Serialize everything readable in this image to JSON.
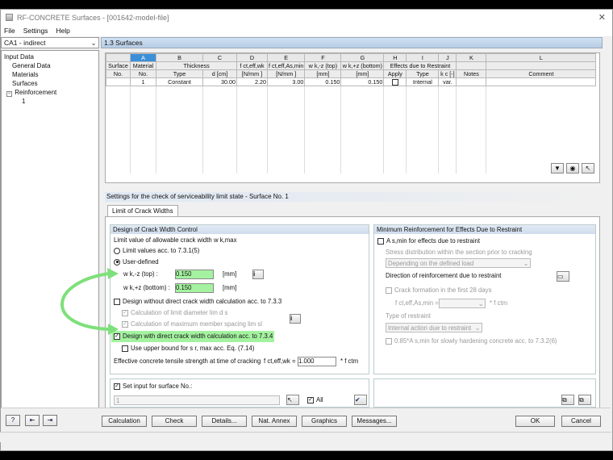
{
  "window": {
    "title": "RF-CONCRETE Surfaces - [001642-model-file]",
    "close": "✕"
  },
  "menu": [
    "File",
    "Settings",
    "Help"
  ],
  "case_selector": {
    "value": "CA1 - indirect"
  },
  "tree": {
    "root": "Input Data",
    "items": [
      "General Data",
      "Materials",
      "Surfaces",
      "Reinforcement"
    ],
    "sub": "1"
  },
  "section_title": "1.3 Surfaces",
  "table": {
    "letters": [
      "A",
      "B",
      "C",
      "D",
      "E",
      "F",
      "G",
      "H",
      "I",
      "J",
      "K",
      "L"
    ],
    "header_top": {
      "surface": "Surface",
      "material": "Material",
      "thickness": "Thickness",
      "fct_eff_wk": "f ct,eff,wk",
      "fct_eff_as": "f ct,eff,As,min",
      "wk_top": "w k,-z (top)",
      "wk_bottom": "w k,+z (bottom)",
      "effects": "Effects due to Restraint",
      "k": "",
      "k_label": "",
      "comment": ""
    },
    "header_bottom": {
      "surface": "No.",
      "material": "No.",
      "type": "Type",
      "d": "d [cm]",
      "fct_eff_wk": "[N/mm ]",
      "fct_eff_as": "[N/mm ]",
      "wk_top": "[mm]",
      "wk_bottom": "[mm]",
      "apply": "Apply",
      "type2": "Type",
      "kc": "k c [-]",
      "notes": "Notes",
      "comment": "Comment"
    },
    "rows": [
      {
        "no": "1",
        "material": "1",
        "type": "Constant",
        "d": "30.00",
        "fct_wk": "2.20",
        "fct_as": "3.00",
        "wk_top": "0.150",
        "wk_bottom": "0.150",
        "type2": "Internal",
        "kc": "var.",
        "notes": "",
        "comment": ""
      }
    ]
  },
  "settings_heading": "Settings for the check of serviceability limit state - Surface No. 1",
  "tab_label": "Limit of Crack Widths",
  "left_group": {
    "title": "Design of Crack Width Control",
    "limit_label": "Limit value of allowable crack width w k,max",
    "opt_limit": "Limit values acc. to 7.3.1(5)",
    "opt_user": "User-defined",
    "wk_top_label": "w k,-z (top) :",
    "wk_top_value": "0.150",
    "wk_bottom_label": "w k,+z (bottom) :",
    "wk_bottom_value": "0.150",
    "unit_mm": "[mm]",
    "design_without": "Design without direct crack width calculation acc. to 7.3.3",
    "calc_diameter": "Calculation of limit diameter lim d s",
    "calc_spacing": "Calculation of maximum member spacing lim sl",
    "design_with": "Design with direct crack width calculation acc. to 7.3.4",
    "upper_bound": "Use upper bound for s r, max acc. Eq. (7.14)",
    "eff_tensile": "Effective concrete tensile strength at time of cracking",
    "fct_label": "f ct,eff,wk =",
    "fct_value": "1.000",
    "fct_unit": "* f ctm"
  },
  "right_group": {
    "title": "Minimum Reinforcement for Effects Due to Restraint",
    "as_min": "A s,min for effects due to restraint",
    "stress_dist": "Stress distribution within the section prior to cracking",
    "stress_dd": "Depending on the defined load",
    "direction": "Direction of reinforcement due to restraint",
    "crack_formation": "Crack formation in the first 28 days",
    "fct_as_label": "f ct,eff,As,min =",
    "fct_as_unit": "* f ctm",
    "type_label": "Type of restraint",
    "type_dd": "Internal action due to restraint",
    "slow_hardening": "0.85*A s,min for slowly hardening concrete acc. to 7.3.2(6)"
  },
  "set_input": {
    "label": "Set input for surface No.:",
    "value": "1",
    "all_label": "All"
  },
  "buttons": {
    "calculation": "Calculation",
    "check": "Check",
    "details": "Details...",
    "nat_annex": "Nat. Annex",
    "graphics": "Graphics",
    "messages": "Messages...",
    "ok": "OK",
    "cancel": "Cancel"
  },
  "colors": {
    "highlight": "#a4f2a0",
    "arrow": "#7ee07a",
    "selection": "#3b8fd8"
  }
}
